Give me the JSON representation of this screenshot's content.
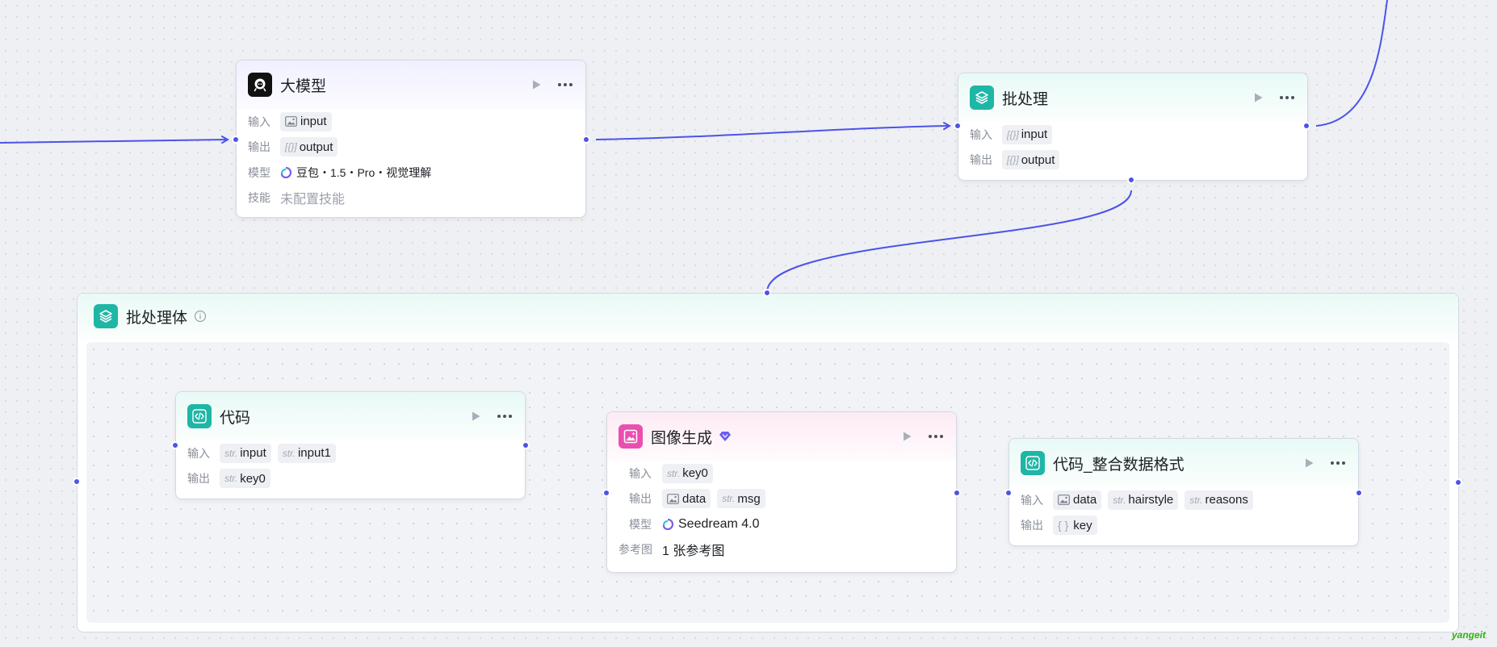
{
  "nodes": {
    "llm": {
      "title": "大模型",
      "input_label": "输入",
      "input_param": "input",
      "output_label": "输出",
      "output_param": "output",
      "model_label": "模型",
      "model_value": "豆包・1.5・Pro・视觉理解",
      "skill_label": "技能",
      "skill_value": "未配置技能"
    },
    "batch": {
      "title": "批处理",
      "input_label": "输入",
      "input_param": "input",
      "output_label": "输出",
      "output_param": "output"
    },
    "batch_body": {
      "title": "批处理体"
    },
    "code": {
      "title": "代码",
      "input_label": "输入",
      "input_type": "str.",
      "input_param1": "input",
      "input_param2": "input1",
      "output_label": "输出",
      "output_type": "str.",
      "output_param": "key0"
    },
    "image_gen": {
      "title": "图像生成",
      "input_label": "输入",
      "input_type": "str.",
      "input_param": "key0",
      "output_label": "输出",
      "output_param1": "data",
      "output_type2": "str.",
      "output_param2": "msg",
      "model_label": "模型",
      "model_value": "Seedream 4.0",
      "ref_label": "参考图",
      "ref_value": "1 张参考图"
    },
    "code_format": {
      "title": "代码_整合数据格式",
      "input_label": "输入",
      "input_param1": "data",
      "input_type2": "str.",
      "input_param2": "hairstyle",
      "input_type3": "str.",
      "input_param3": "reasons",
      "output_label": "输出",
      "output_type": "{ }",
      "output_param": "key"
    }
  },
  "watermark": "yangeit",
  "colors": {
    "edge": "#4d53e8",
    "teal": "#1eb6a5",
    "pink": "#ea4fb0",
    "brand": "#2fb30b"
  }
}
